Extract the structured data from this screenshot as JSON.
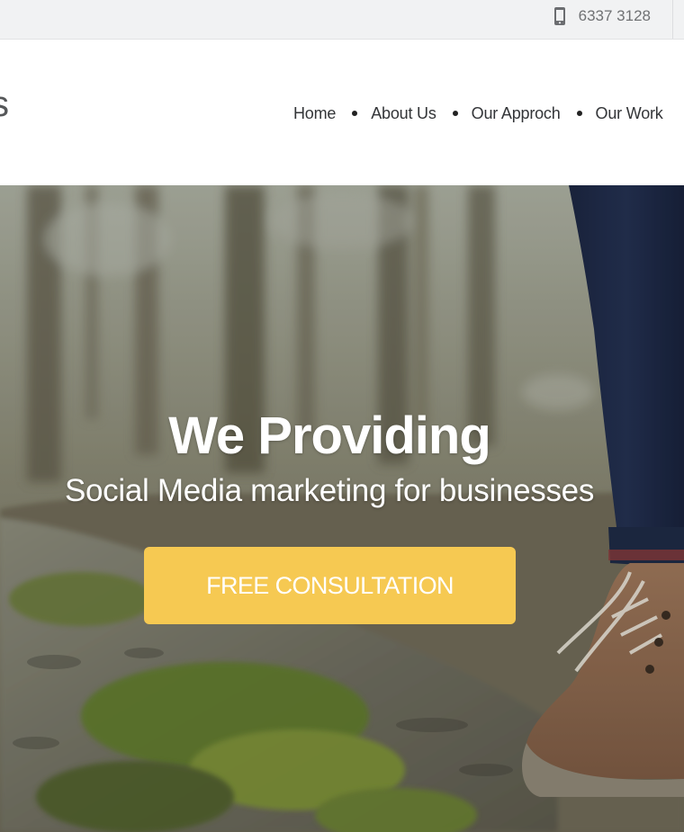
{
  "topbar": {
    "phone_icon": "mobile-phone-icon",
    "phone_number": "6337 3128"
  },
  "header": {
    "logo_fragment": "s",
    "nav": [
      {
        "label": "Home"
      },
      {
        "label": "About Us"
      },
      {
        "label": "Our Approch"
      },
      {
        "label": "Our Work"
      }
    ]
  },
  "hero": {
    "title": "We Providing",
    "subtitle": "Social Media marketing for businesses",
    "cta_label": "FREE CONSULTATION",
    "background": "forest path with hiking boot photo"
  },
  "colors": {
    "topbar_bg": "#f1f2f3",
    "cta_bg": "#f6c952",
    "nav_text": "#333538",
    "hero_text": "#ffffff"
  }
}
